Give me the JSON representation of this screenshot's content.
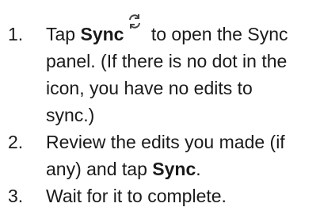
{
  "steps": [
    {
      "number": "1.",
      "pre": "Tap ",
      "bold": "Sync",
      "icon": "sync-icon",
      "post": " to open the Sync panel. (If there is no dot in the icon, you have no edits to sync.)"
    },
    {
      "number": "2.",
      "pre": "Review the edits you made (if any) and tap ",
      "bold": "Sync",
      "post": "."
    },
    {
      "number": "3.",
      "text": "Wait for it to complete."
    }
  ]
}
